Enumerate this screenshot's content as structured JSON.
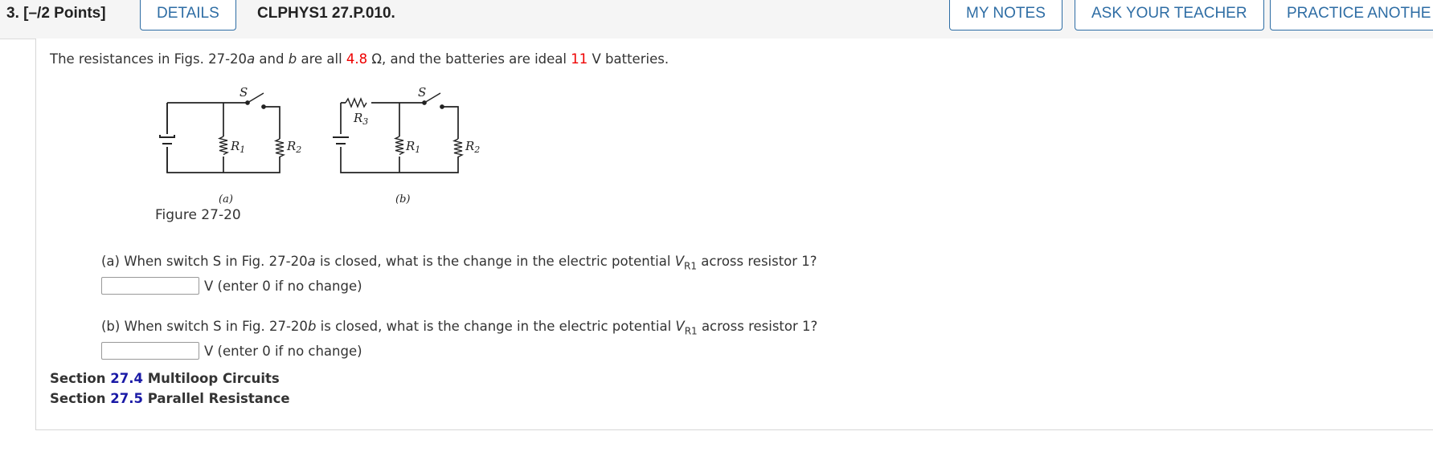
{
  "header": {
    "question_number": "3.",
    "points": "[–/2 Points]",
    "details_label": "DETAILS",
    "question_code": "CLPHYS1 27.P.010.",
    "my_notes_label": "MY NOTES",
    "ask_teacher_label": "ASK YOUR TEACHER",
    "practice_label": "PRACTICE ANOTHE"
  },
  "intro": {
    "p1": "The resistances in Figs. 27-20",
    "a": "a",
    "p2": " and ",
    "b": "b",
    "p3": " are all ",
    "resistance": "4.8",
    "p4": " Ω, and the batteries are ideal ",
    "voltage": "11",
    "p5": " V batteries."
  },
  "figure": {
    "caption": "Figure 27-20",
    "label_a": "(a)",
    "label_b": "(b)",
    "switch": "S",
    "r1": "R",
    "r1_sub": "1",
    "r2": "R",
    "r2_sub": "2",
    "r3": "R",
    "r3_sub": "3"
  },
  "part_a": {
    "prefix": "(a) When switch S in Fig. 27-20",
    "fig": "a",
    "middle": " is closed, what is the change in the electric potential ",
    "v": "V",
    "v_sub": "R1",
    "suffix": " across resistor 1?",
    "value": "",
    "unit": "V (enter 0 if no change)"
  },
  "part_b": {
    "prefix": "(b) When switch S in Fig. 27-20",
    "fig": "b",
    "middle": " is closed, what is the change in the electric potential ",
    "v": "V",
    "v_sub": "R1",
    "suffix": " across resistor 1?",
    "value": "",
    "unit": "V (enter 0 if no change)"
  },
  "sections": [
    {
      "word": "Section",
      "number": "27.4",
      "title": "Multiloop Circuits"
    },
    {
      "word": "Section",
      "number": "27.5",
      "title": "Parallel Resistance"
    }
  ]
}
